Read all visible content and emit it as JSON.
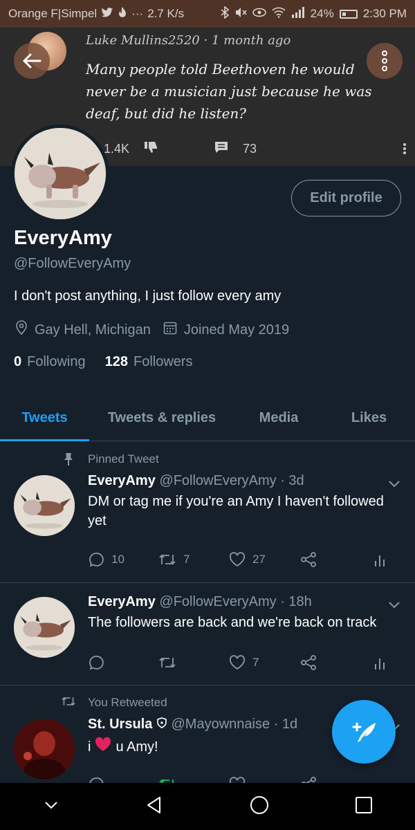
{
  "status_bar": {
    "carrier": "Orange F|Simpel",
    "speed": "2.7 K/s",
    "battery": "24%",
    "time": "2:30 PM"
  },
  "banner": {
    "author": "Luke Mullins2520",
    "separator": "·",
    "age": "1 month ago",
    "text": "Many people told Beethoven he would never be a musician just because he was deaf, but did he listen?",
    "likes": "1.4K",
    "comments": "73"
  },
  "profile": {
    "name": "EveryAmy",
    "handle": "@FollowEveryAmy",
    "bio": "I don't post anything, I just follow every amy",
    "location": "Gay Hell, Michigan",
    "joined": "Joined May 2019",
    "following_count": "0",
    "following_label": "Following",
    "followers_count": "128",
    "followers_label": "Followers",
    "edit_button": "Edit profile"
  },
  "tabs": [
    {
      "label": "Tweets",
      "active": true
    },
    {
      "label": "Tweets & replies",
      "active": false
    },
    {
      "label": "Media",
      "active": false
    },
    {
      "label": "Likes",
      "active": false
    }
  ],
  "tweets": [
    {
      "context": "Pinned Tweet",
      "name": "EveryAmy",
      "handle": "@FollowEveryAmy",
      "time": "· 3d",
      "text": "DM or tag me if you're an Amy I haven't followed yet",
      "replies": "10",
      "retweets": "7",
      "likes": "27"
    },
    {
      "context": "",
      "name": "EveryAmy",
      "handle": "@FollowEveryAmy",
      "time": "· 18h",
      "text": "The followers are back and we're back on track",
      "replies": "",
      "retweets": "",
      "likes": "7"
    },
    {
      "context": "You Retweeted",
      "name": "St. Ursula",
      "handle": "@Mayownnaise",
      "time": "· 1d",
      "text_before": "i",
      "text_after": "u Amy!"
    }
  ],
  "colors": {
    "background": "#15202b",
    "accent": "#1da1f2",
    "muted": "#8899a6",
    "divider": "#38444d",
    "heart": "#e0245e"
  }
}
